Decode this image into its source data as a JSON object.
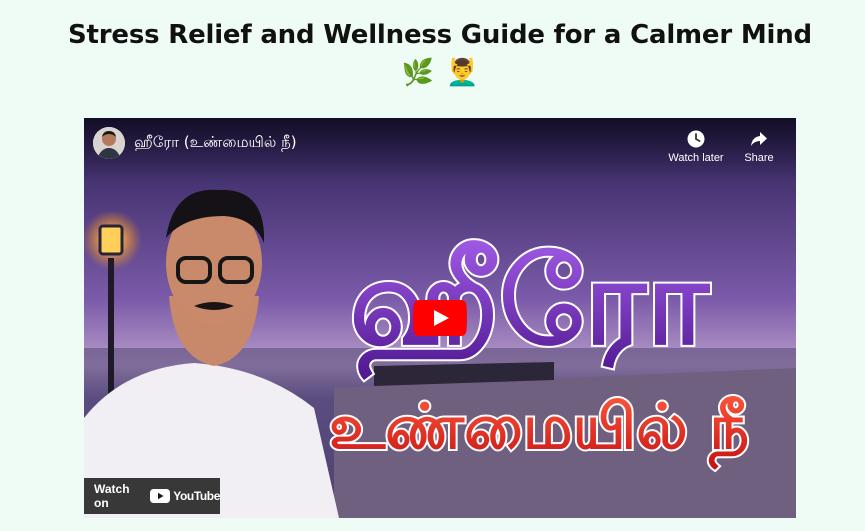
{
  "page": {
    "heading": "Stress Relief and Wellness Guide for a Calmer Mind",
    "heading_emojis": [
      "🌿",
      "💆‍♂️"
    ]
  },
  "video": {
    "title": "ஹீரோ (உண்மையில் நீ)",
    "thumbnail_text_line1": "ஹீரோ",
    "thumbnail_text_line2": "உண்மையில் நீ",
    "watch_later_label": "Watch later",
    "share_label": "Share",
    "watch_on_label": "Watch on",
    "platform_name": "YouTube",
    "icons": {
      "play": "play-icon",
      "watch_later": "clock-icon",
      "share": "share-arrow-icon",
      "platform": "youtube-logo-icon"
    },
    "colors": {
      "play_button": "#ff0000",
      "thumbnail_headline": "#7a2cc4",
      "thumbnail_subline": "#e8231b"
    }
  }
}
